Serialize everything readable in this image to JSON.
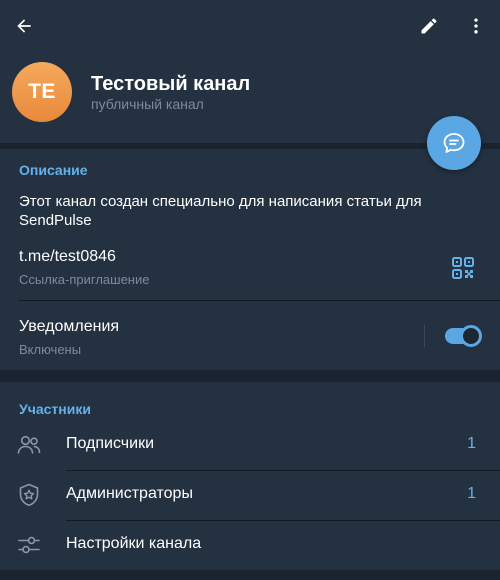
{
  "header": {
    "avatar_initials": "TE",
    "title": "Тестовый канал",
    "subtitle": "публичный канал",
    "icons": [
      "back-arrow-icon",
      "pencil-icon",
      "more-vert-icon",
      "chat-bubble-icon"
    ]
  },
  "info": {
    "section_title": "Описание",
    "description": "Этот канал создан специально для написания статьи для SendPulse",
    "link": "t.me/test0846",
    "link_label": "Ссылка-приглашение",
    "notifications_label": "Уведомления",
    "notifications_status": "Включены",
    "notifications_enabled": true
  },
  "members": {
    "section_title": "Участники",
    "rows": [
      {
        "label": "Подписчики",
        "count": "1",
        "icon": "people-icon"
      },
      {
        "label": "Администраторы",
        "count": "1",
        "icon": "shield-star-icon"
      },
      {
        "label": "Настройки канала",
        "count": "",
        "icon": "sliders-icon"
      }
    ]
  },
  "colors": {
    "accent": "#64b1ec",
    "fab": "#5aa7e3",
    "avatar": "#ef9a4e",
    "background": "#1c2733",
    "panel": "#243141"
  }
}
